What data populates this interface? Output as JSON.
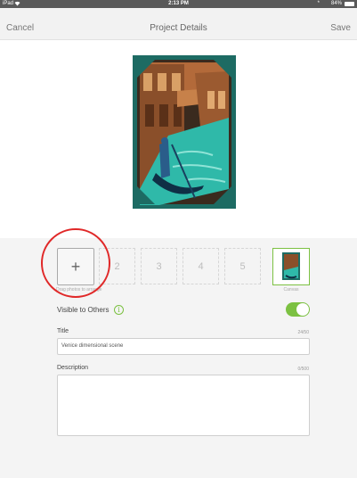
{
  "status_bar": {
    "device": "iPad",
    "time": "2:13 PM",
    "bluetooth": "*",
    "battery": "84%"
  },
  "nav": {
    "cancel_label": "Cancel",
    "title": "Project Details",
    "save_label": "Save"
  },
  "photos": {
    "add_label": "+",
    "slots": [
      "2",
      "3",
      "4",
      "5"
    ],
    "drag_hint": "Drag photos to arrange",
    "canvas_label": "Canvas"
  },
  "visibility": {
    "label": "Visible to Others",
    "info_glyph": "i",
    "enabled": true
  },
  "title_field": {
    "label": "Title",
    "count": "24/50",
    "value": "Venice dimensional scene"
  },
  "description_field": {
    "label": "Description",
    "count": "0/500",
    "value": ""
  },
  "colors": {
    "accent_green": "#7cc142",
    "annotation_red": "#e02828",
    "canal_teal": "#2fb9a9",
    "frame_dark": "#1d6b63",
    "building_brown": "#8a4f2a"
  }
}
